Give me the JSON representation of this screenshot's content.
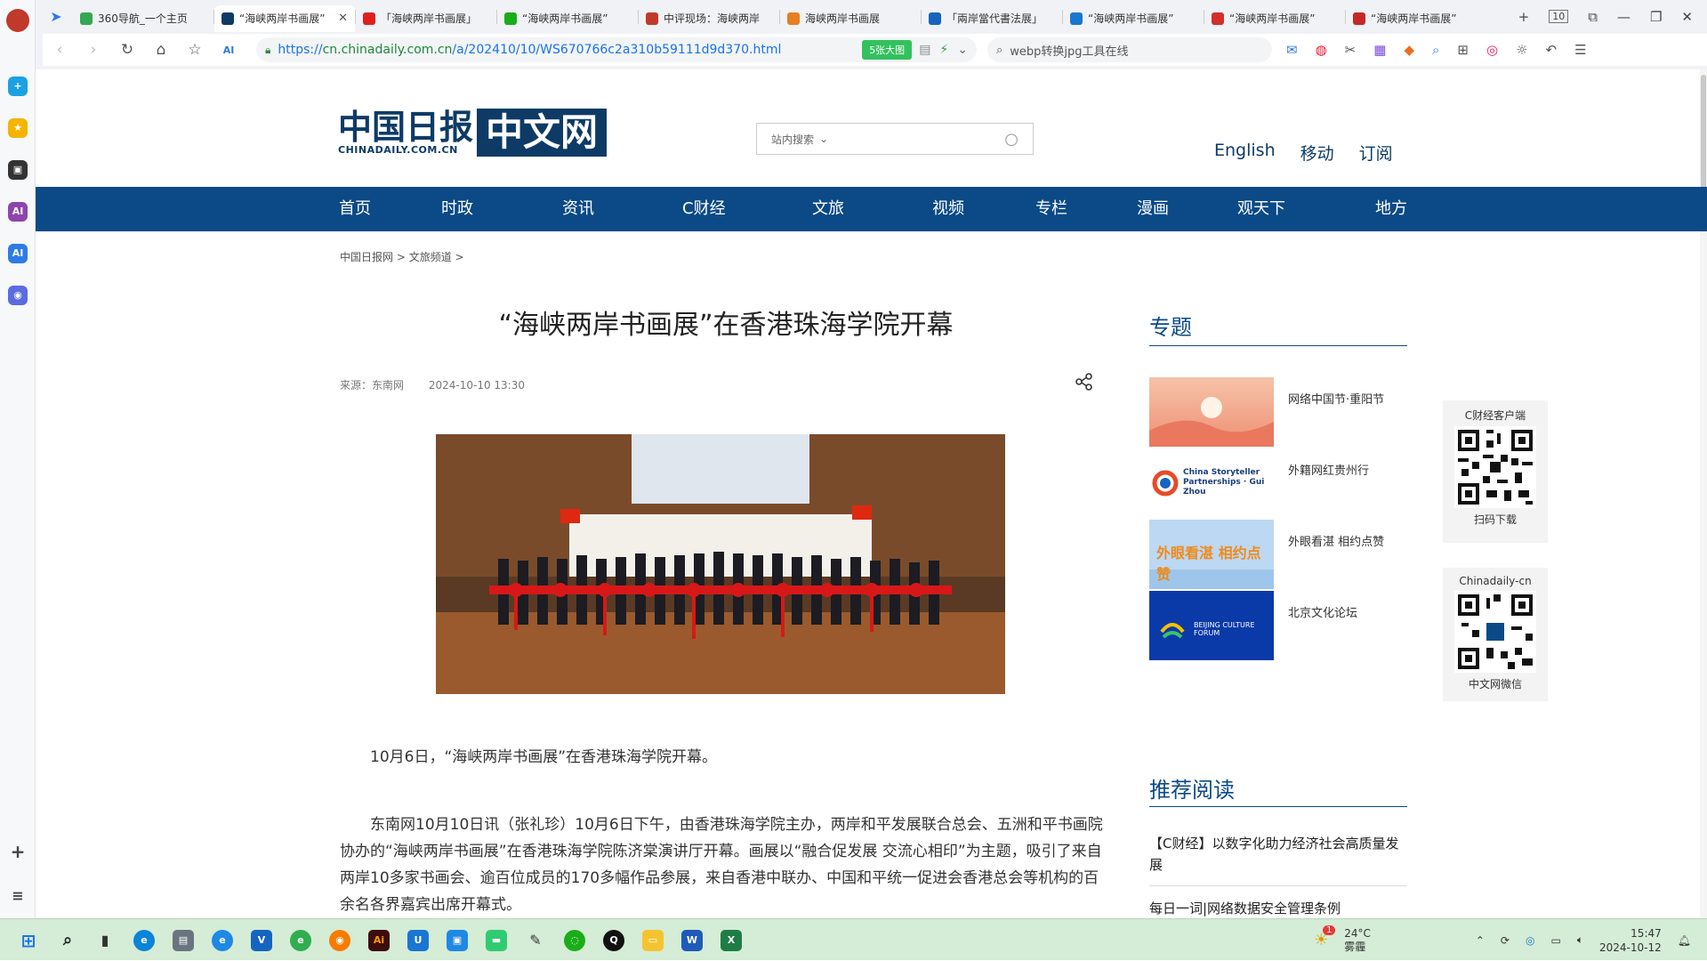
{
  "tabs": [
    {
      "title": "360导航_一个主页",
      "color": "#33a853",
      "active": false
    },
    {
      "title": "“海峡两岸书画展”",
      "color": "#0d3b66",
      "active": true
    },
    {
      "title": "「海峡两岸书画展」",
      "color": "#e02020",
      "active": false
    },
    {
      "title": "“海峡两岸书画展”",
      "color": "#1aad19",
      "active": false
    },
    {
      "title": "中评现场：海峡两岸",
      "color": "#c0392b",
      "active": false
    },
    {
      "title": "海峡两岸书画展",
      "color": "#e67e22",
      "active": false
    },
    {
      "title": "「兩岸當代書法展」",
      "color": "#1565c0",
      "active": false
    },
    {
      "title": "“海峡两岸书画展”",
      "color": "#1976d2",
      "active": false
    },
    {
      "title": "“海峡两岸书画展”",
      "color": "#d32f2f",
      "active": false
    },
    {
      "title": "“海峡两岸书画展”",
      "color": "#c62828",
      "active": false
    }
  ],
  "tab_count": "10",
  "address": {
    "scheme": "https://",
    "host": "cn.chinadaily.com.cn",
    "path": "/a/202410/10/WS670766c2a310b59111d9d370.html",
    "badge": "5张大图"
  },
  "search_box": {
    "value": "webp转换jpg工具在线"
  },
  "site": {
    "logo_cn": "中国日报",
    "logo_en": "CHINADAILY.COM.CN",
    "logo_box": "中文网",
    "search_placeholder": "站内搜索",
    "top_links": [
      "English",
      "移动",
      "订阅"
    ],
    "nav": [
      "首页",
      "时政",
      "资讯",
      "C财经",
      "文旅",
      "视频",
      "专栏",
      "漫画",
      "观天下",
      "地方"
    ]
  },
  "breadcrumb": [
    "中国日报网",
    "文旅频道"
  ],
  "article": {
    "title": "“海峡两岸书画展”在香港珠海学院开幕",
    "source": "来源：东南网",
    "datetime": "2024-10-10 13:30",
    "para1": "10月6日，“海峡两岸书画展”在香港珠海学院开幕。",
    "para2": "东南网10月10日讯（张礼珍）10月6日下午，由香港珠海学院主办，两岸和平发展联合总会、五洲和平书画院协办的“海峡两岸书画展”在香港珠海学院陈济棠演讲厅开幕。画展以“融合促发展 交流心相印”为主题，吸引了来自两岸10多家书画会、逾百位成员的170多幅作品参展，来自香港中联办、中国和平统一促进会香港总会等机构的百余名各界嘉宾出席开幕式。"
  },
  "sidebar": {
    "topics_heading": "专题",
    "topics": [
      "网络中国节·重阳节",
      "外籍网红贵州行",
      "外眼看湛 相约点赞",
      "北京文化论坛"
    ],
    "topic_thumb_text": {
      "t2": "China Storyteller Partnerships · Gui Zhou",
      "t3": "外眼看湛 相约点赞",
      "t4": "BEIJING CULTURE FORUM"
    },
    "recommend_heading": "推荐阅读",
    "recommend": [
      "【C财经】以数字化助力经济社会高质量发展",
      "每日一词|网络数据安全管理条例"
    ]
  },
  "qr_cards": [
    {
      "title": "C财经客户端",
      "caption": "扫码下载"
    },
    {
      "title": "Chinadaily-cn",
      "caption": "中文网微信"
    }
  ],
  "taskbar": {
    "weather_temp": "24°C",
    "weather_desc": "雾霾",
    "time": "15:47",
    "date": "2024-10-12",
    "notify_badge": "1"
  },
  "colors": {
    "brand": "#0b4a86",
    "taskbar": "#d5ecd6"
  }
}
